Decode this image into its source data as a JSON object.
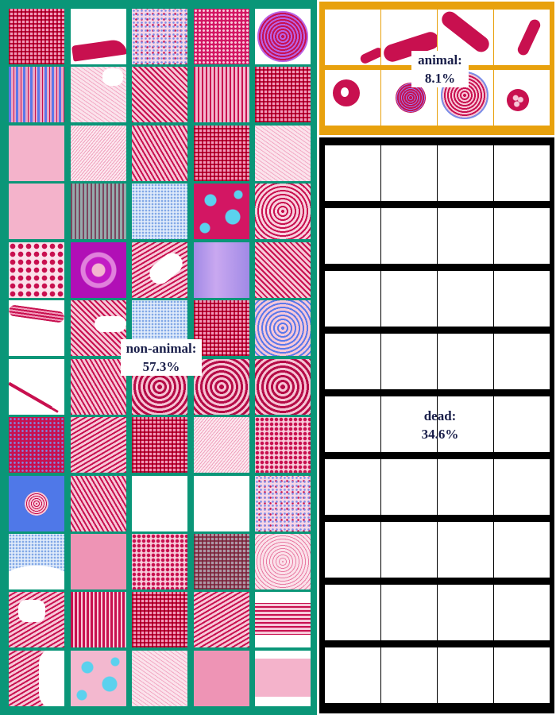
{
  "categories": [
    {
      "name": "non-animal",
      "percent": "57.3%",
      "color": "#0a9678"
    },
    {
      "name": "animal",
      "percent": "8.1%",
      "color": "#e8a10d"
    },
    {
      "name": "dead",
      "percent": "34.6%",
      "color": "#000000"
    }
  ],
  "labels": {
    "non_animal_name": "non-animal:",
    "non_animal_pct": "57.3%",
    "animal_name": "animal:",
    "animal_pct": "8.1%",
    "dead_name": "dead:",
    "dead_pct": "34.6%"
  }
}
